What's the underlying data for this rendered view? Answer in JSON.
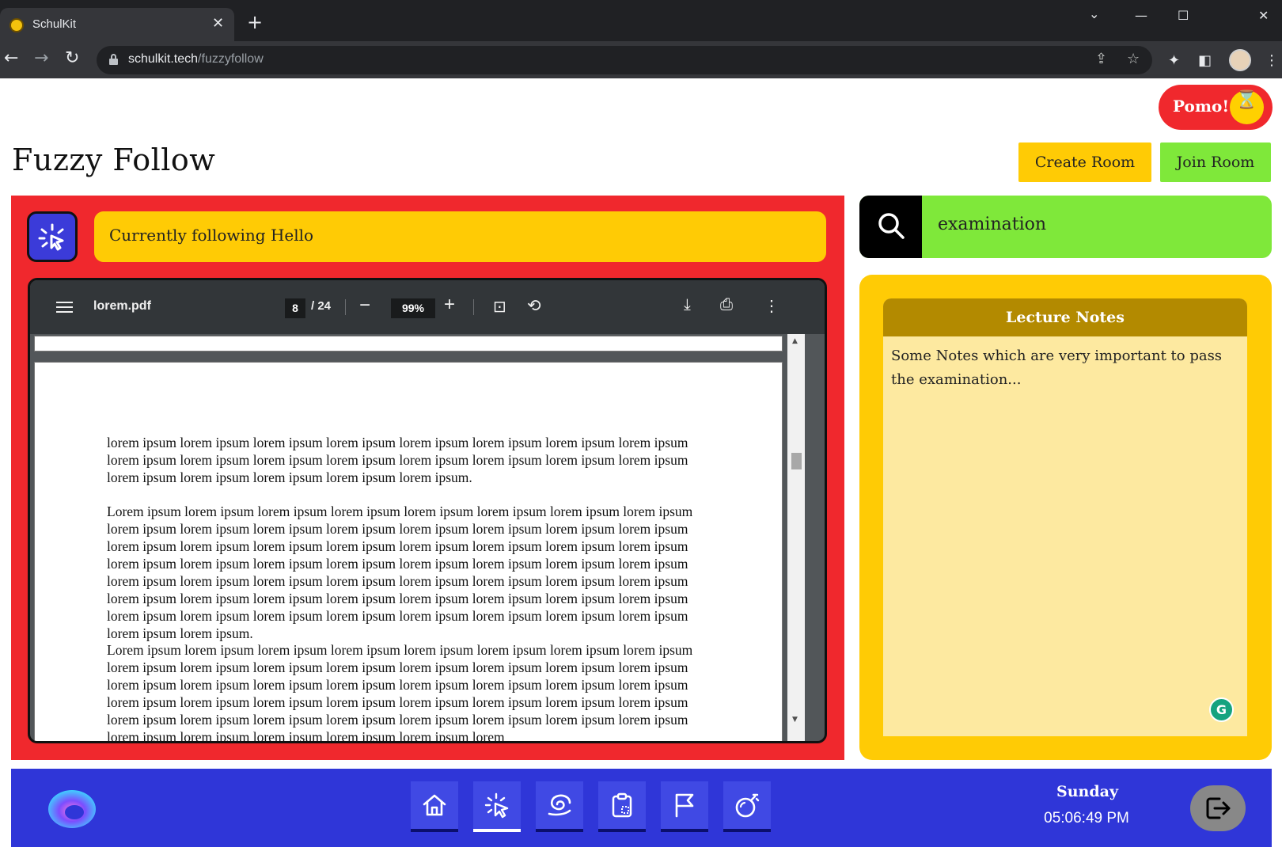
{
  "browser": {
    "tab_title": "SchulKit",
    "tab_close": "✕",
    "new_tab": "+",
    "url_host": "schulkit.tech",
    "url_path": "/fuzzyfollow"
  },
  "header": {
    "pomo_label": "Pomo!",
    "page_title": "Fuzzy Follow",
    "create_room_label": "Create Room",
    "join_room_label": "Join Room"
  },
  "follow": {
    "status_text": "Currently following Hello"
  },
  "pdf_viewer": {
    "file_name": "lorem.pdf",
    "current_page": "8",
    "total_pages": "/ 24",
    "zoom": "99%",
    "paragraphs": [
      "lorem ipsum lorem ipsum lorem ipsum lorem ipsum lorem ipsum lorem ipsum lorem ipsum lorem ipsum lorem ipsum lorem ipsum lorem ipsum lorem ipsum lorem ipsum lorem ipsum lorem ipsum lorem ipsum lorem ipsum lorem ipsum lorem ipsum lorem ipsum lorem ipsum.",
      "Lorem ipsum lorem ipsum lorem ipsum lorem ipsum lorem ipsum lorem ipsum lorem ipsum lorem ipsum lorem ipsum lorem ipsum lorem ipsum lorem ipsum lorem ipsum lorem ipsum lorem ipsum lorem ipsum lorem ipsum lorem ipsum lorem ipsum lorem ipsum lorem ipsum lorem ipsum lorem ipsum lorem ipsum lorem ipsum lorem ipsum lorem ipsum lorem ipsum lorem ipsum lorem ipsum lorem ipsum lorem ipsum lorem ipsum lorem ipsum lorem ipsum lorem ipsum lorem ipsum lorem ipsum lorem ipsum lorem ipsum lorem ipsum lorem ipsum lorem ipsum lorem ipsum lorem ipsum lorem ipsum lorem ipsum lorem ipsum lorem ipsum lorem ipsum lorem ipsum lorem ipsum lorem ipsum lorem ipsum lorem ipsum lorem ipsum lorem ipsum lorem ipsum.",
      "Lorem ipsum lorem ipsum lorem ipsum lorem ipsum lorem ipsum lorem ipsum lorem ipsum lorem ipsum lorem ipsum lorem ipsum lorem ipsum lorem ipsum lorem ipsum lorem ipsum lorem ipsum lorem ipsum lorem ipsum lorem ipsum lorem ipsum lorem ipsum lorem ipsum lorem ipsum lorem ipsum lorem ipsum lorem ipsum lorem ipsum lorem ipsum lorem ipsum lorem ipsum lorem ipsum lorem ipsum lorem ipsum lorem ipsum lorem ipsum lorem ipsum lorem ipsum lorem ipsum lorem ipsum lorem ipsum lorem ipsum lorem ipsum lorem ipsum lorem ipsum lorem ipsum lorem ipsum lorem"
    ]
  },
  "search": {
    "value": "examination"
  },
  "notes": {
    "title": "Lecture Notes",
    "body": "Some Notes which are very important to pass the examination..."
  },
  "footer": {
    "nav_items": [
      {
        "icon": "home-icon"
      },
      {
        "icon": "fuzzy-follow-icon",
        "active": true
      },
      {
        "icon": "swirl-icon"
      },
      {
        "icon": "clipboard-icon"
      },
      {
        "icon": "flag-icon"
      },
      {
        "icon": "bomb-icon"
      }
    ],
    "day": "Sunday",
    "time": "05:06:49 PM"
  },
  "colors": {
    "red": "#f0282d",
    "yellow": "#ffcb05",
    "green": "#7fe83a",
    "blue": "#2f36d8",
    "notes_header": "#b38a00"
  }
}
